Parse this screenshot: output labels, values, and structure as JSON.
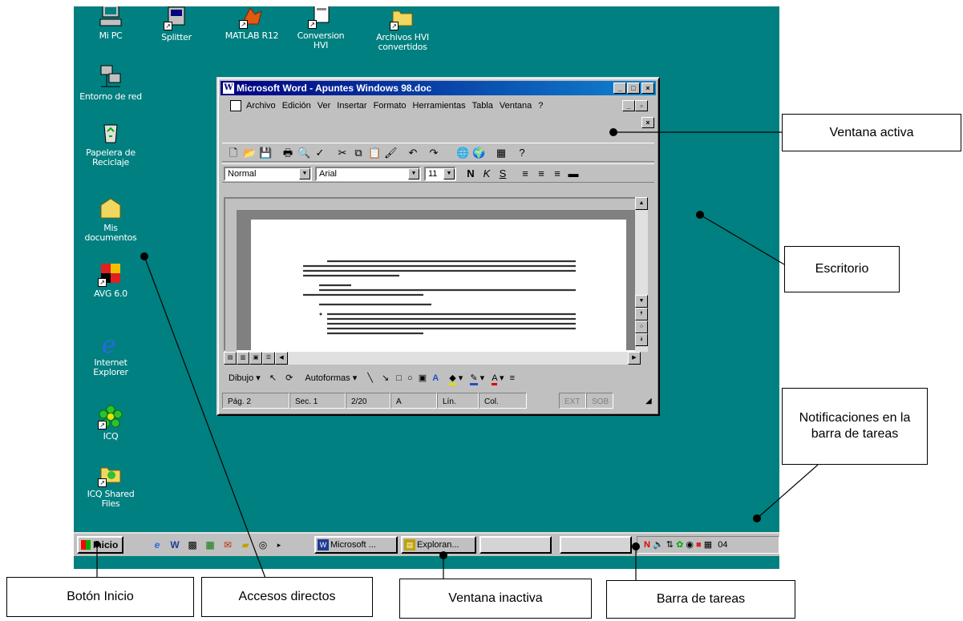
{
  "desktop_icons": [
    {
      "name": "mipc",
      "label": "Mi PC",
      "icon": "computer-icon"
    },
    {
      "name": "splitter",
      "label": "Splitter",
      "icon": "program-icon"
    },
    {
      "name": "matlab",
      "label": "MATLAB R12",
      "icon": "matlab-icon"
    },
    {
      "name": "conversion",
      "label": "Conversion\nHVI",
      "icon": "program-icon"
    },
    {
      "name": "archivos",
      "label": "Archivos HVI\nconvertidos",
      "icon": "folder-icon"
    },
    {
      "name": "entorno",
      "label": "Entorno de red",
      "icon": "network-icon"
    },
    {
      "name": "papelera",
      "label": "Papelera de\nReciclaje",
      "icon": "recycle-bin-icon"
    },
    {
      "name": "misdocs",
      "label": "Mis\ndocumentos",
      "icon": "folder-icon"
    },
    {
      "name": "avg",
      "label": "AVG 6.0",
      "icon": "avg-icon"
    },
    {
      "name": "ie",
      "label": "Internet\nExplorer",
      "icon": "ie-icon"
    },
    {
      "name": "icq",
      "label": "ICQ",
      "icon": "icq-flower-icon"
    },
    {
      "name": "icqshared",
      "label": "ICQ Shared\nFiles",
      "icon": "folder-icon"
    }
  ],
  "word": {
    "title": "Microsoft Word - Apuntes Windows 98.doc",
    "menus": [
      "Archivo",
      "Edición",
      "Ver",
      "Insertar",
      "Formato",
      "Herramientas",
      "Tabla",
      "Ventana",
      "?"
    ],
    "style_value": "Normal",
    "font_value": "Arial",
    "size_value": "11",
    "draw_label": "Dibujo",
    "autoshapes_label": "Autoformas",
    "status": {
      "page": "Pág. 2",
      "section": "Sec. 1",
      "pages": "2/20",
      "at": "A",
      "line": "Lín.",
      "col": "Col.",
      "ext": "EXT",
      "sob": "SOB"
    }
  },
  "taskbar": {
    "start_label": "Inicio",
    "tasks": [
      "Microsoft ...",
      "Exploran..."
    ],
    "clock": "04"
  },
  "callouts": {
    "ventana_activa": "Ventana activa",
    "escritorio": "Escritorio",
    "notificaciones": "Notificaciones en la barra de tareas",
    "boton_inicio": "Botón Inicio",
    "accesos_directos": "Accesos directos",
    "ventana_inactiva": "Ventana inactiva",
    "barra_tareas": "Barra de tareas"
  },
  "colors": {
    "desktop": "#008080",
    "titlebar": "#000080",
    "face": "#c0c0c0"
  }
}
